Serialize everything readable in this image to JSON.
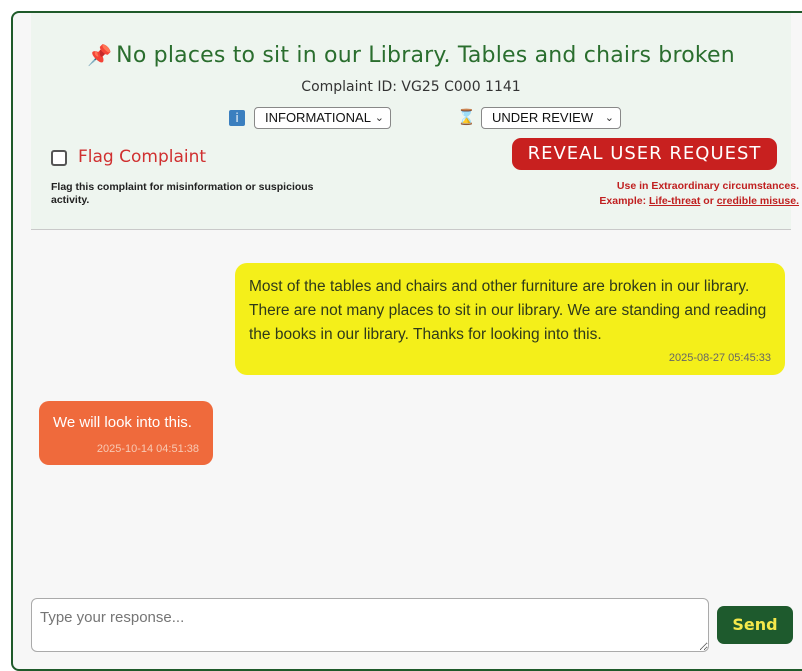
{
  "complaint": {
    "title": "No places to sit in our Library. Tables and chairs broken",
    "id_text": "Complaint ID: VG25 C000 1141",
    "category_select": "INFORMATIONAL",
    "status_select": "UNDER REVIEW",
    "flag_label": "Flag Complaint",
    "flag_description": "Flag this complaint for misinformation or suspicious activity.",
    "reveal_button": "REVEAL USER REQUEST",
    "reveal_note_line1": "Use in Extraordinary circumstances.",
    "reveal_note_prefix": "Example: ",
    "reveal_note_link1": "Life-threat",
    "reveal_note_or": " or ",
    "reveal_note_link2": "credible misuse."
  },
  "messages": [
    {
      "from": "user",
      "text": "Most of the tables and chairs and other furniture are broken in our library. There are not many places to sit in our library. We are standing and reading the books in our library. Thanks for looking into this.",
      "time": "2025-08-27 05:45:33"
    },
    {
      "from": "admin",
      "text": "We will look into this.",
      "time": "2025-10-14 04:51:38"
    }
  ],
  "composer": {
    "placeholder": "Type your response...",
    "send_label": "Send"
  },
  "icons": {
    "pin": "pushpin-icon",
    "info": "info-icon",
    "hourglass": "hourglass-icon"
  },
  "colors": {
    "brand_green": "#1e5a2d",
    "user_bubble": "#f4ef1a",
    "admin_bubble": "#ef6a3c",
    "alert_red": "#c8201f"
  }
}
